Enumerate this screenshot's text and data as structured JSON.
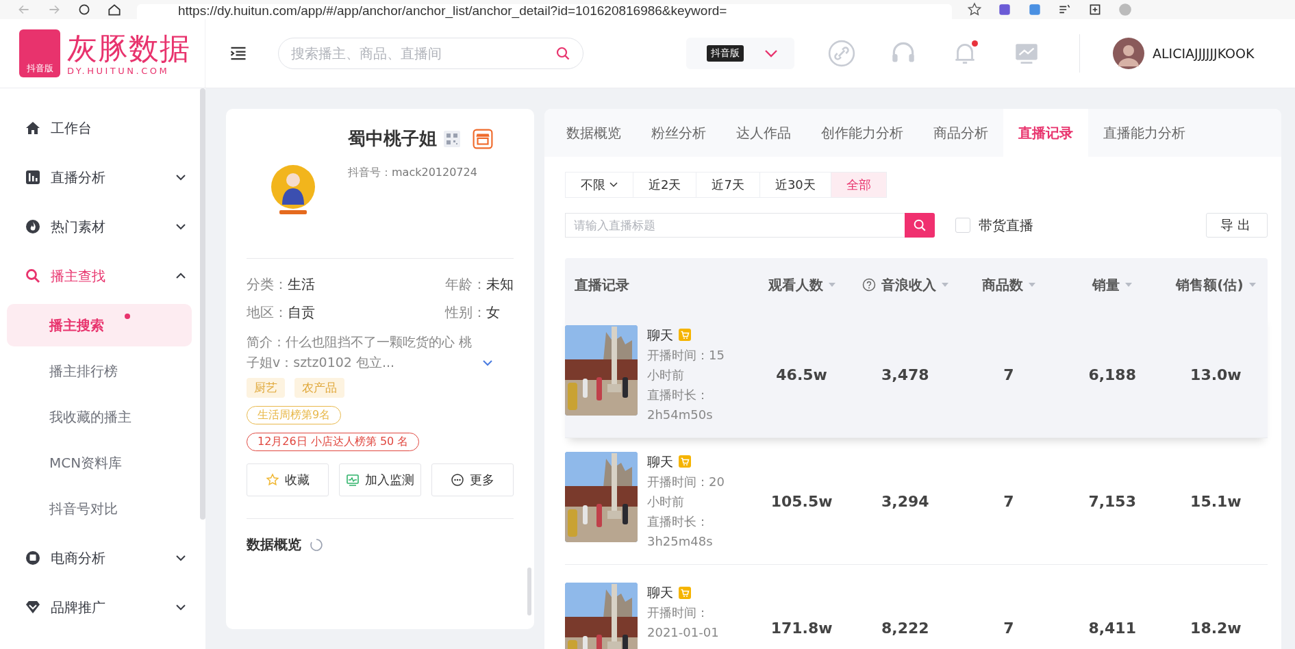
{
  "browser": {
    "url": "https://dy.huitun.com/app/#/app/anchor/anchor_list/anchor_detail?id=101620816986&keyword="
  },
  "logo": {
    "name": "灰豚数据",
    "badge": "抖音版",
    "domain": "DY.HUITUN.COM"
  },
  "header": {
    "search_placeholder": "搜索播主、商品、直播间",
    "version": "抖音版",
    "notification_dot": true,
    "user": "ALICIAJJJJJJKOOK"
  },
  "sidebar": {
    "items": [
      {
        "label": "工作台",
        "selected": false
      },
      {
        "label": "直播分析",
        "selected": false,
        "expanded": false
      },
      {
        "label": "热门素材",
        "selected": false,
        "expanded": false
      },
      {
        "label": "播主查找",
        "selected": true,
        "expanded": true,
        "children": [
          {
            "label": "播主搜索",
            "selected": true,
            "dot": true
          },
          {
            "label": "播主排行榜",
            "selected": false,
            "dot": false
          },
          {
            "label": "我收藏的播主",
            "selected": false,
            "dot": false
          },
          {
            "label": "MCN资料库",
            "selected": false,
            "dot": false
          },
          {
            "label": "抖音号对比",
            "selected": false,
            "dot": false
          }
        ]
      },
      {
        "label": "电商分析",
        "selected": false,
        "expanded": false
      },
      {
        "label": "品牌推广",
        "selected": false,
        "expanded": false
      }
    ]
  },
  "profile": {
    "name": "蜀中桃子姐",
    "id_label": "抖音号：",
    "id_value": "mack20120724",
    "fields": [
      {
        "label": "分类：",
        "value": "生活"
      },
      {
        "label": "年龄：",
        "value": "未知"
      },
      {
        "label": "地区：",
        "value": "自贡"
      },
      {
        "label": "性别：",
        "value": "女"
      }
    ],
    "intro_label": "简介：",
    "intro": "什么也阻挡不了一颗吃货的心 桃子姐v：sztz0102 包立...",
    "tags": [
      "厨艺",
      "农产品"
    ],
    "ranks": [
      {
        "text": "生活周榜第9名",
        "color": "#e8b84a"
      },
      {
        "text": "12月26日 小店达人榜第 50 名",
        "color": "#e0473f"
      }
    ],
    "actions": [
      "收藏",
      "加入监测",
      "更多"
    ],
    "section": "数据概览"
  },
  "tabs": [
    {
      "label": "数据概览",
      "selected": false
    },
    {
      "label": "粉丝分析",
      "selected": false
    },
    {
      "label": "达人作品",
      "selected": false
    },
    {
      "label": "创作能力分析",
      "selected": false
    },
    {
      "label": "商品分析",
      "selected": false
    },
    {
      "label": "直播记录",
      "selected": true
    },
    {
      "label": "直播能力分析",
      "selected": false
    }
  ],
  "range_select": "不限",
  "ranges": [
    {
      "label": "近2天",
      "selected": false
    },
    {
      "label": "近7天",
      "selected": false
    },
    {
      "label": "近30天",
      "selected": false
    },
    {
      "label": "全部",
      "selected": true
    }
  ],
  "search_placeholder": "请输入直播标题",
  "goods_filter": {
    "label": "带货直播",
    "checked": false
  },
  "export": "导出",
  "table": {
    "columns": [
      {
        "label": "直播记录",
        "kind": "plain"
      },
      {
        "label": "观看人数",
        "kind": "sort"
      },
      {
        "label": "音浪收入",
        "kind": "help-sort"
      },
      {
        "label": "商品数",
        "kind": "sort"
      },
      {
        "label": "销量",
        "kind": "sort"
      },
      {
        "label": "销售额(估)",
        "kind": "sort"
      }
    ],
    "rows": [
      {
        "title": "聊天",
        "cart": true,
        "highlighted": true,
        "start": "开播时间：15小时前",
        "duration": "直播时长：2h54m50s",
        "viewers": "46.5w",
        "income": "3,478",
        "products": "7",
        "sales": "6,188",
        "revenue": "13.0w"
      },
      {
        "title": "聊天",
        "cart": true,
        "highlighted": false,
        "start": "开播时间：20小时前",
        "duration": "直播时长：3h25m48s",
        "viewers": "105.5w",
        "income": "3,294",
        "products": "7",
        "sales": "7,153",
        "revenue": "15.1w"
      },
      {
        "title": "聊天",
        "cart": true,
        "highlighted": false,
        "start": "开播时间：2021-01-01",
        "viewers": "171.8w",
        "income": "8,222",
        "products": "7",
        "sales": "8,411",
        "revenue": "18.2w"
      }
    ]
  }
}
